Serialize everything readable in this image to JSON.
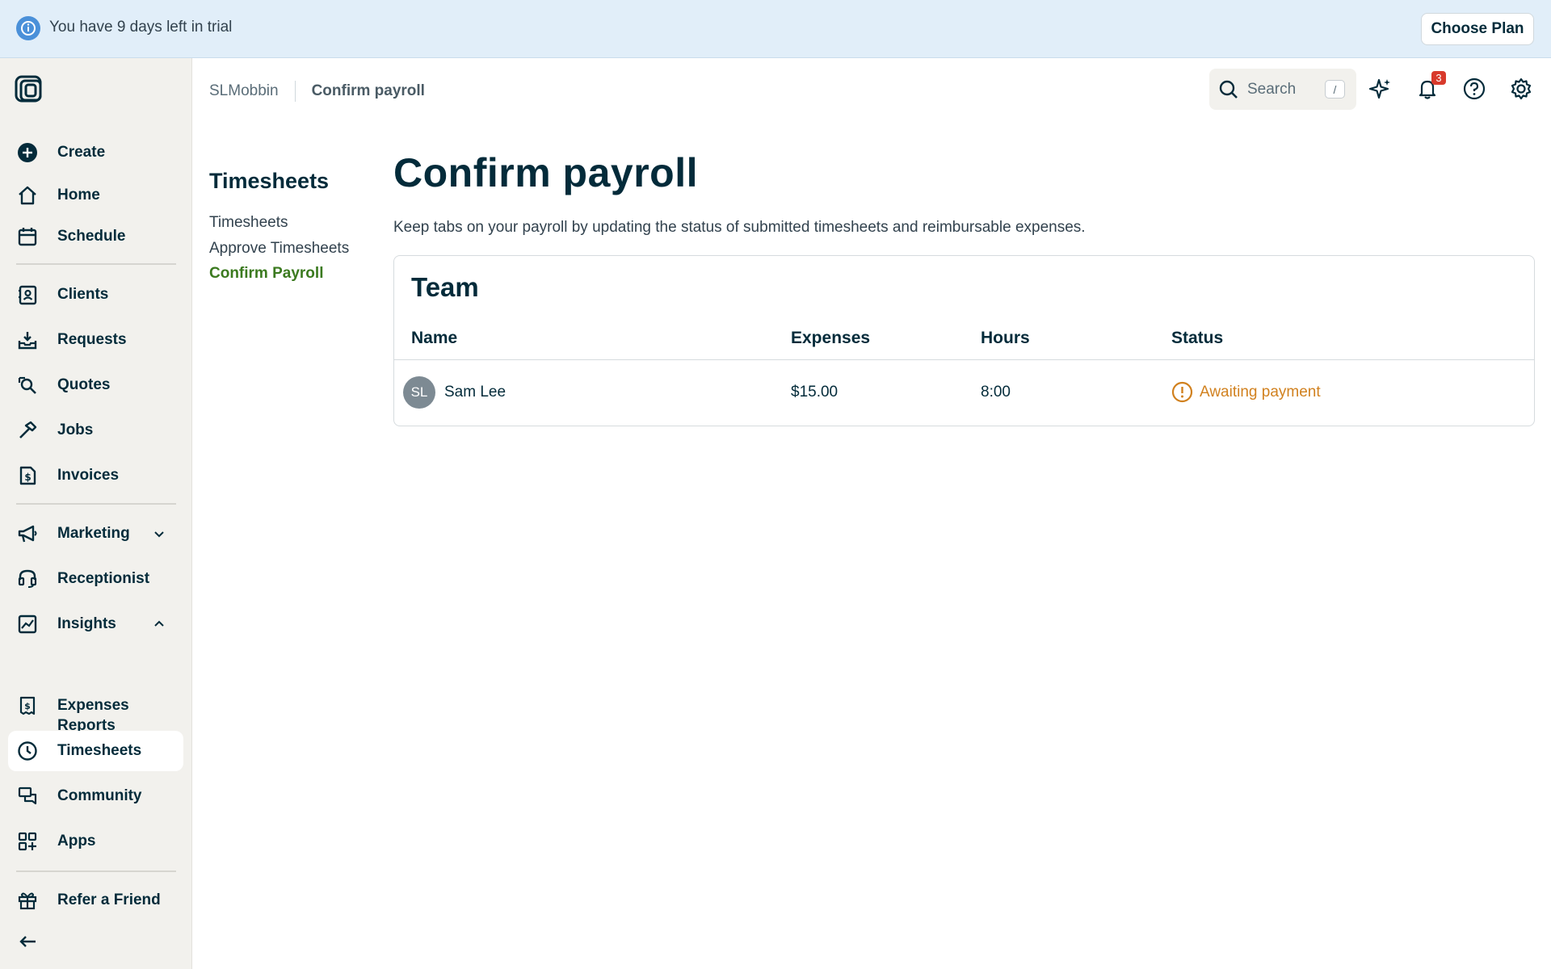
{
  "banner": {
    "trial_text": "You have 9 days left in trial",
    "choose_plan_label": "Choose Plan"
  },
  "sidebar": {
    "items": [
      {
        "label": "Create",
        "icon": "plus-circle-icon"
      },
      {
        "label": "Home",
        "icon": "home-icon"
      },
      {
        "label": "Schedule",
        "icon": "calendar-icon"
      },
      {
        "label": "Clients",
        "icon": "contact-card-icon"
      },
      {
        "label": "Requests",
        "icon": "inbox-download-icon"
      },
      {
        "label": "Quotes",
        "icon": "quote-search-icon"
      },
      {
        "label": "Jobs",
        "icon": "hammer-icon"
      },
      {
        "label": "Invoices",
        "icon": "invoice-dollar-icon"
      },
      {
        "label": "Marketing",
        "icon": "megaphone-icon"
      },
      {
        "label": "Receptionist",
        "icon": "headset-icon"
      },
      {
        "label": "Insights",
        "icon": "chart-icon"
      },
      {
        "label": "Reports"
      },
      {
        "label": "Expenses",
        "icon": "receipt-dollar-icon"
      },
      {
        "label": "Timesheets",
        "icon": "clock-icon"
      },
      {
        "label": "Community",
        "icon": "chat-bubbles-icon"
      },
      {
        "label": "Apps",
        "icon": "apps-grid-icon"
      },
      {
        "label": "Refer a Friend",
        "icon": "gift-icon"
      }
    ],
    "active_item": "Timesheets"
  },
  "header": {
    "account_name": "SLMobbin",
    "breadcrumb_current": "Confirm payroll",
    "search_placeholder": "Search",
    "search_shortcut": "/",
    "notification_count": "3"
  },
  "subnav": {
    "title": "Timesheets",
    "links": [
      "Timesheets",
      "Approve Timesheets",
      "Confirm Payroll"
    ],
    "active_link": "Confirm Payroll"
  },
  "main": {
    "title": "Confirm payroll",
    "description": "Keep tabs on your payroll by updating the status of submitted timesheets and reimbursable expenses.",
    "card_title": "Team",
    "columns": [
      "Name",
      "Expenses",
      "Hours",
      "Status"
    ],
    "rows": [
      {
        "initials": "SL",
        "name": "Sam Lee",
        "expenses": "$15.00",
        "hours": "8:00",
        "status": "Awaiting payment"
      }
    ]
  },
  "colors": {
    "brand_dark": "#032b3a",
    "active_green": "#3b7a1f",
    "warning_orange": "#d1811f",
    "notification_red": "#d83a2c",
    "banner_blue": "#e1eef9",
    "sidebar_bg": "#f2f1ed"
  }
}
